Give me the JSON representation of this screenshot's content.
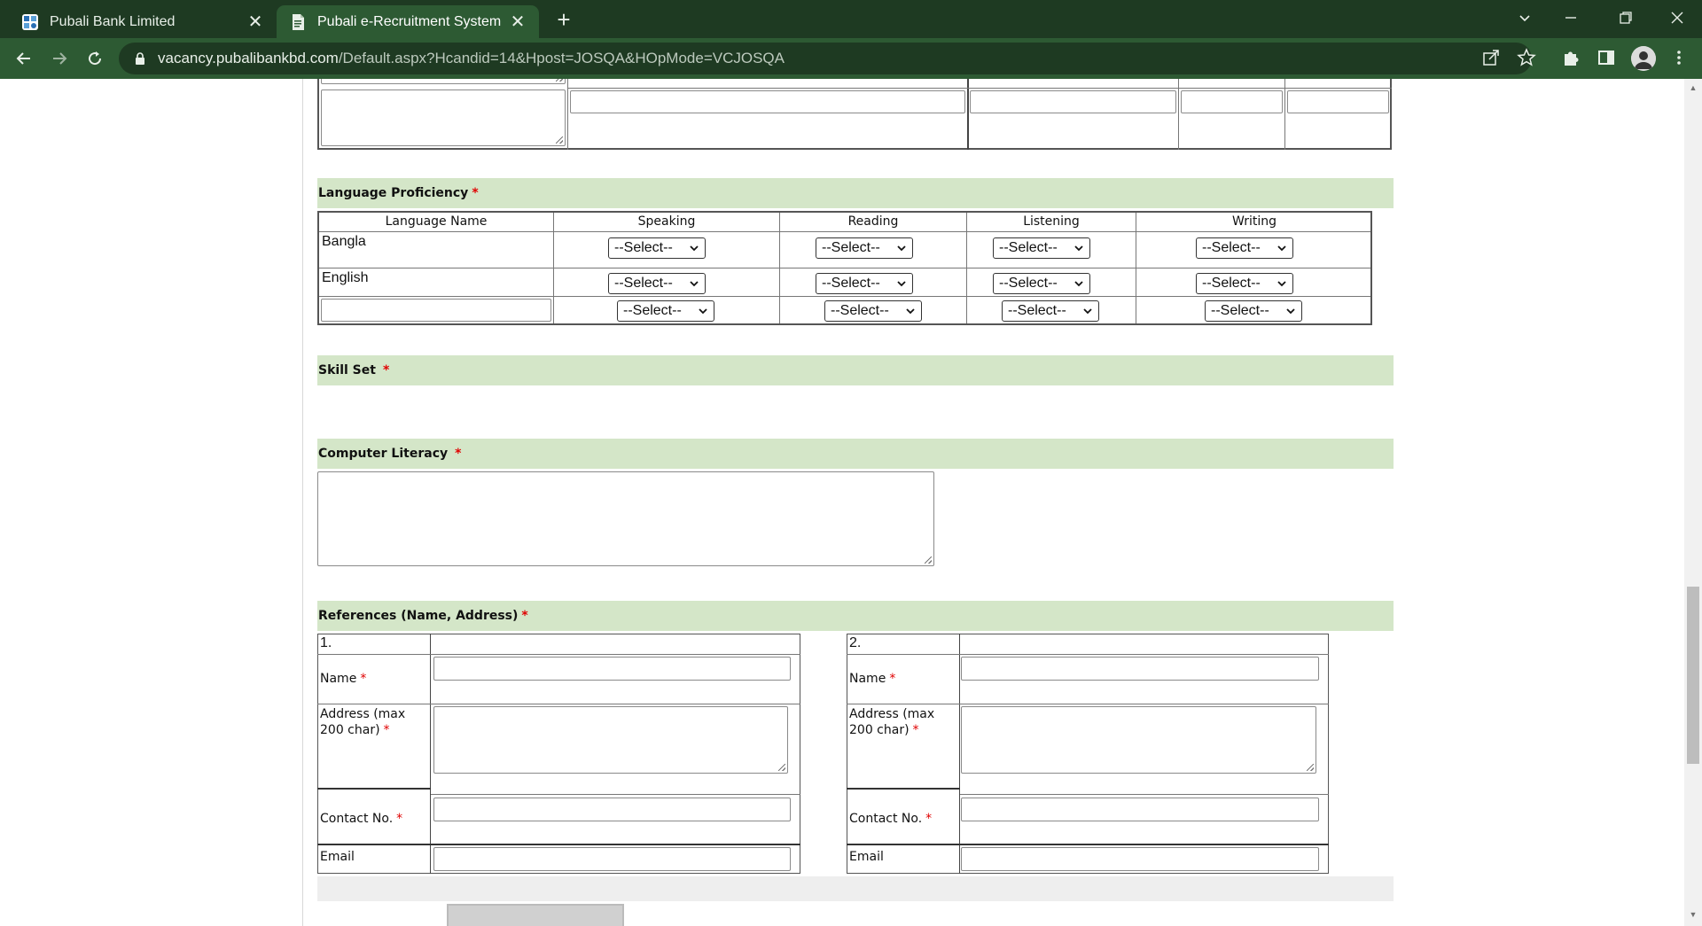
{
  "browser": {
    "tabs": [
      {
        "title": "Pubali Bank Limited",
        "active": false
      },
      {
        "title": "Pubali e-Recruitment System",
        "active": true
      }
    ],
    "url_host": "vacancy.pubalibankbd.com",
    "url_path": "/Default.aspx?Hcandid=14&Hpost=JOSQA&HOpMode=VCJOSQA",
    "theme_colors": {
      "frame": "#1e3a22",
      "toolbar": "#2d5a33"
    }
  },
  "language_section": {
    "title": "Language Proficiency",
    "required_mark": "*",
    "columns": [
      "Language Name",
      "Speaking",
      "Reading",
      "Listening",
      "Writing"
    ],
    "rows": [
      {
        "name": "Bangla",
        "speaking": "--Select--",
        "reading": "--Select--",
        "listening": "--Select--",
        "writing": "--Select--"
      },
      {
        "name": "English",
        "speaking": "--Select--",
        "reading": "--Select--",
        "listening": "--Select--",
        "writing": "--Select--"
      },
      {
        "name": "",
        "speaking": "--Select--",
        "reading": "--Select--",
        "listening": "--Select--",
        "writing": "--Select--"
      }
    ]
  },
  "skill_section": {
    "title": "Skill Set",
    "required_mark": "*"
  },
  "computer_section": {
    "title": "Computer Literacy",
    "required_mark": "*",
    "value": ""
  },
  "references_section": {
    "title": "References (Name, Address)",
    "required_mark": "*",
    "refs": [
      {
        "number": "1.",
        "name_label": "Name",
        "address_label_1": "Address (max",
        "address_label_2": "200 char)",
        "contact_label": "Contact No.",
        "email_label": "Email",
        "name": "",
        "address": "",
        "contact": "",
        "email": ""
      },
      {
        "number": "2.",
        "name_label": "Name",
        "address_label_1": "Address (max",
        "address_label_2": "200 char)",
        "contact_label": "Contact No.",
        "email_label": "Email",
        "name": "",
        "address": "",
        "contact": "",
        "email": ""
      }
    ]
  },
  "accent_colors": {
    "section_bar": "#d4e6c8",
    "required": "#e00000"
  }
}
